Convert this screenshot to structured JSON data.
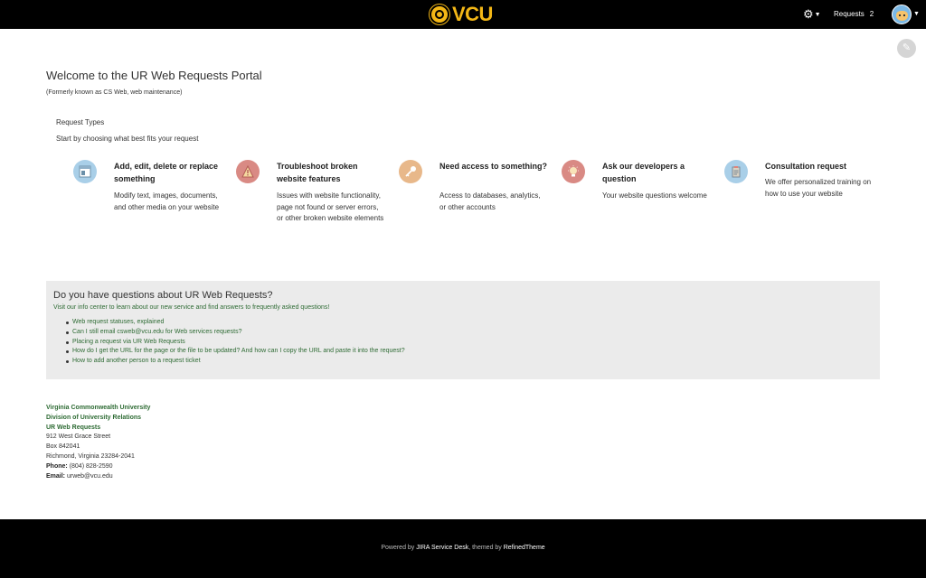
{
  "header": {
    "logo_text": "VCU",
    "requests_label": "Requests",
    "requests_count": "2"
  },
  "page": {
    "title": "Welcome to the UR Web Requests Portal",
    "subtitle": "(Formerly known as CS Web, web maintenance)",
    "section_label": "Request Types",
    "section_hint": "Start by choosing what best fits your request"
  },
  "request_types": [
    {
      "title": "Add, edit, delete or replace something",
      "description": "Modify text, images, documents, and other media on your website",
      "icon": "document-icon",
      "color": "#a9cfe8"
    },
    {
      "title": "Troubleshoot broken website features",
      "description": "Issues with website functionality, page not found or server errors, or other broken website elements",
      "icon": "warning-icon",
      "color": "#d98a84"
    },
    {
      "title": "Need access to something?",
      "description": "Access to databases, analytics, or other accounts",
      "icon": "key-icon",
      "color": "#e8b88a"
    },
    {
      "title": "Ask our developers a question",
      "description": "Your website questions welcome",
      "icon": "lightbulb-icon",
      "color": "#d98a84"
    },
    {
      "title": "Consultation request",
      "description": "We offer personalized training on how to use your website",
      "icon": "clipboard-icon",
      "color": "#a9cfe8"
    }
  ],
  "faq": {
    "title": "Do you have questions about UR Web Requests?",
    "intro": "Visit our info center to learn about our new service and find answers to frequently asked questions!",
    "links": [
      "Web request statuses, explained",
      "Can I still email csweb@vcu.edu for Web services requests?",
      "Placing a request via UR Web Requests",
      "How do I get the URL for the page or the file to be updated? And how can I copy the URL and paste it into the request?",
      "How to add another person to a request ticket"
    ]
  },
  "contact": {
    "org1": "Virginia Commonwealth University",
    "org2": "Division of University Relations",
    "org3": "UR Web Requests",
    "street": "912 West Grace Street",
    "box": "Box 842041",
    "city": "Richmond, Virginia 23284-2041",
    "phone_label": "Phone:",
    "phone": "(804) 828-2590",
    "email_label": "Email:",
    "email": "urweb@vcu.edu"
  },
  "footer": {
    "powered_prefix": "Powered by",
    "product": "JIRA Service Desk",
    "themed_by": ", themed by",
    "theme": "RefinedTheme"
  }
}
